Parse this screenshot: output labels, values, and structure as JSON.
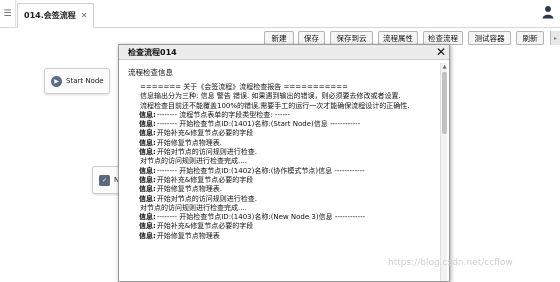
{
  "tab": {
    "label": "014.会签流程",
    "close": "✕"
  },
  "toolbar": {
    "buttons": [
      "新建",
      "保存",
      "保存到云",
      "流程属性",
      "检查流程",
      "测试容器",
      "刷新"
    ]
  },
  "canvas": {
    "start_node": "Start Node",
    "node2_fragment": "N"
  },
  "dialog": {
    "title": "检查流程014",
    "close": "✕",
    "section": "流程检查信息",
    "lines": [
      {
        "label": "",
        "text": "======= 关于《会签流程》流程检查报告 ==========="
      },
      {
        "label": "",
        "text": "信息输出分为三种: 信息 警告 错误. 如果遇到输出的错误，则必须要去修改或者设置."
      },
      {
        "label": "",
        "text": "流程检查目前还不能覆盖100%的错误,需要手工的运行一次才能确保流程设计的正确性."
      },
      {
        "label": "信息:",
        "text": "-------- 流程节点表单的字段类型检查: ------"
      },
      {
        "label": "信息:",
        "text": "-------- 开始检查节点ID:(1401)名称:(Start Node)信息 ------------"
      },
      {
        "label": "信息:",
        "text": "开始补充&修复节点必要的字段"
      },
      {
        "label": "信息:",
        "text": "开始修复节点物理表."
      },
      {
        "label": "信息:",
        "text": "开始对节点的访问规则进行检查."
      },
      {
        "label": "",
        "text": "对节点的访问规则进行检查完成...."
      },
      {
        "label": "信息:",
        "text": "-------- 开始检查节点ID:(1402)名称:(协作模式节点)信息 ------------"
      },
      {
        "label": "信息:",
        "text": "开始补充&修复节点必要的字段"
      },
      {
        "label": "信息:",
        "text": "开始修复节点物理表."
      },
      {
        "label": "信息:",
        "text": "开始对节点的访问规则进行检查."
      },
      {
        "label": "",
        "text": "对节点的访问规则进行检查完成...."
      },
      {
        "label": "信息:",
        "text": "-------- 开始检查节点ID:(1403)名称:(New Node 3)信息 ------------"
      },
      {
        "label": "信息:",
        "text": "开始补充&修复节点必要的字段"
      },
      {
        "label": "信息:",
        "text": "开始修复节点物理表"
      }
    ]
  },
  "watermark": "https://blog.csdn.net/ccflow"
}
